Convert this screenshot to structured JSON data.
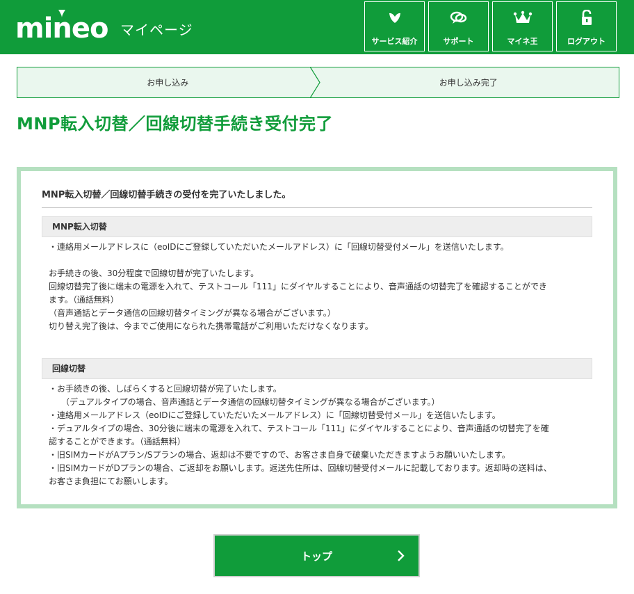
{
  "header": {
    "logo": "mineo",
    "subtitle": "マイページ",
    "nav": [
      {
        "label": "サービス紹介",
        "icon": "heart-leaf-icon"
      },
      {
        "label": "サポート",
        "icon": "chat-bubbles-icon"
      },
      {
        "label": "マイネ王",
        "icon": "crown-icon"
      },
      {
        "label": "ログアウト",
        "icon": "unlock-icon"
      }
    ]
  },
  "steps": {
    "step1": "お申し込み",
    "step2": "お申し込み完了"
  },
  "page_title": "MNP転入切替／回線切替手続き受付完了",
  "box": {
    "heading": "MNP転入切替／回線切替手続きの受付を完了いたしました。",
    "mnp": {
      "title": "MNP転入切替",
      "line1": "・連絡用メールアドレスに（eoIDにご登録していただいたメールアドレス）に「回線切替受付メール」を送信いたします。",
      "line2": "お手続きの後、30分程度で回線切替が完了いたします。",
      "line3": "回線切替完了後に端末の電源を入れて、テストコール「111」にダイヤルすることにより、音声通話の切替完了を確認することができ",
      "line4": "ます。（通話無料）",
      "line5": "（音声通話とデータ通信の回線切替タイミングが異なる場合がございます。）",
      "line6": "切り替え完了後は、今までご使用になられた携帯電話がご利用いただけなくなります。"
    },
    "line_switch": {
      "title": "回線切替",
      "line1": "・お手続きの後、しばらくすると回線切替が完了いたします。",
      "line2": "（デュアルタイプの場合、音声通話とデータ通信の回線切替タイミングが異なる場合がございます。）",
      "line3": "・連絡用メールアドレス（eoIDにご登録していただいたメールアドレス）に「回線切替受付メール」を送信いたします。",
      "line4": "・デュアルタイプの場合、30分後に端末の電源を入れて、テストコール「111」にダイヤルすることにより、音声通話の切替完了を確",
      "line5": "認することができます。（通話無料）",
      "line6": "・旧SIMカードがAプラン/Sプランの場合、返却は不要ですので、お客さま自身で破棄いただきますようお願いいたします。",
      "line7": "・旧SIMカードがDプランの場合、ご返却をお願いします。返送先住所は、回線切替受付メールに記載しております。返却時の送料は、",
      "line8": "お客さま負担にてお願いします。"
    }
  },
  "top_button": {
    "label": "トップ"
  },
  "colors": {
    "brand_green": "#109c3a",
    "box_border": "#b5e0c0",
    "step_bg": "#eaf7ee"
  }
}
